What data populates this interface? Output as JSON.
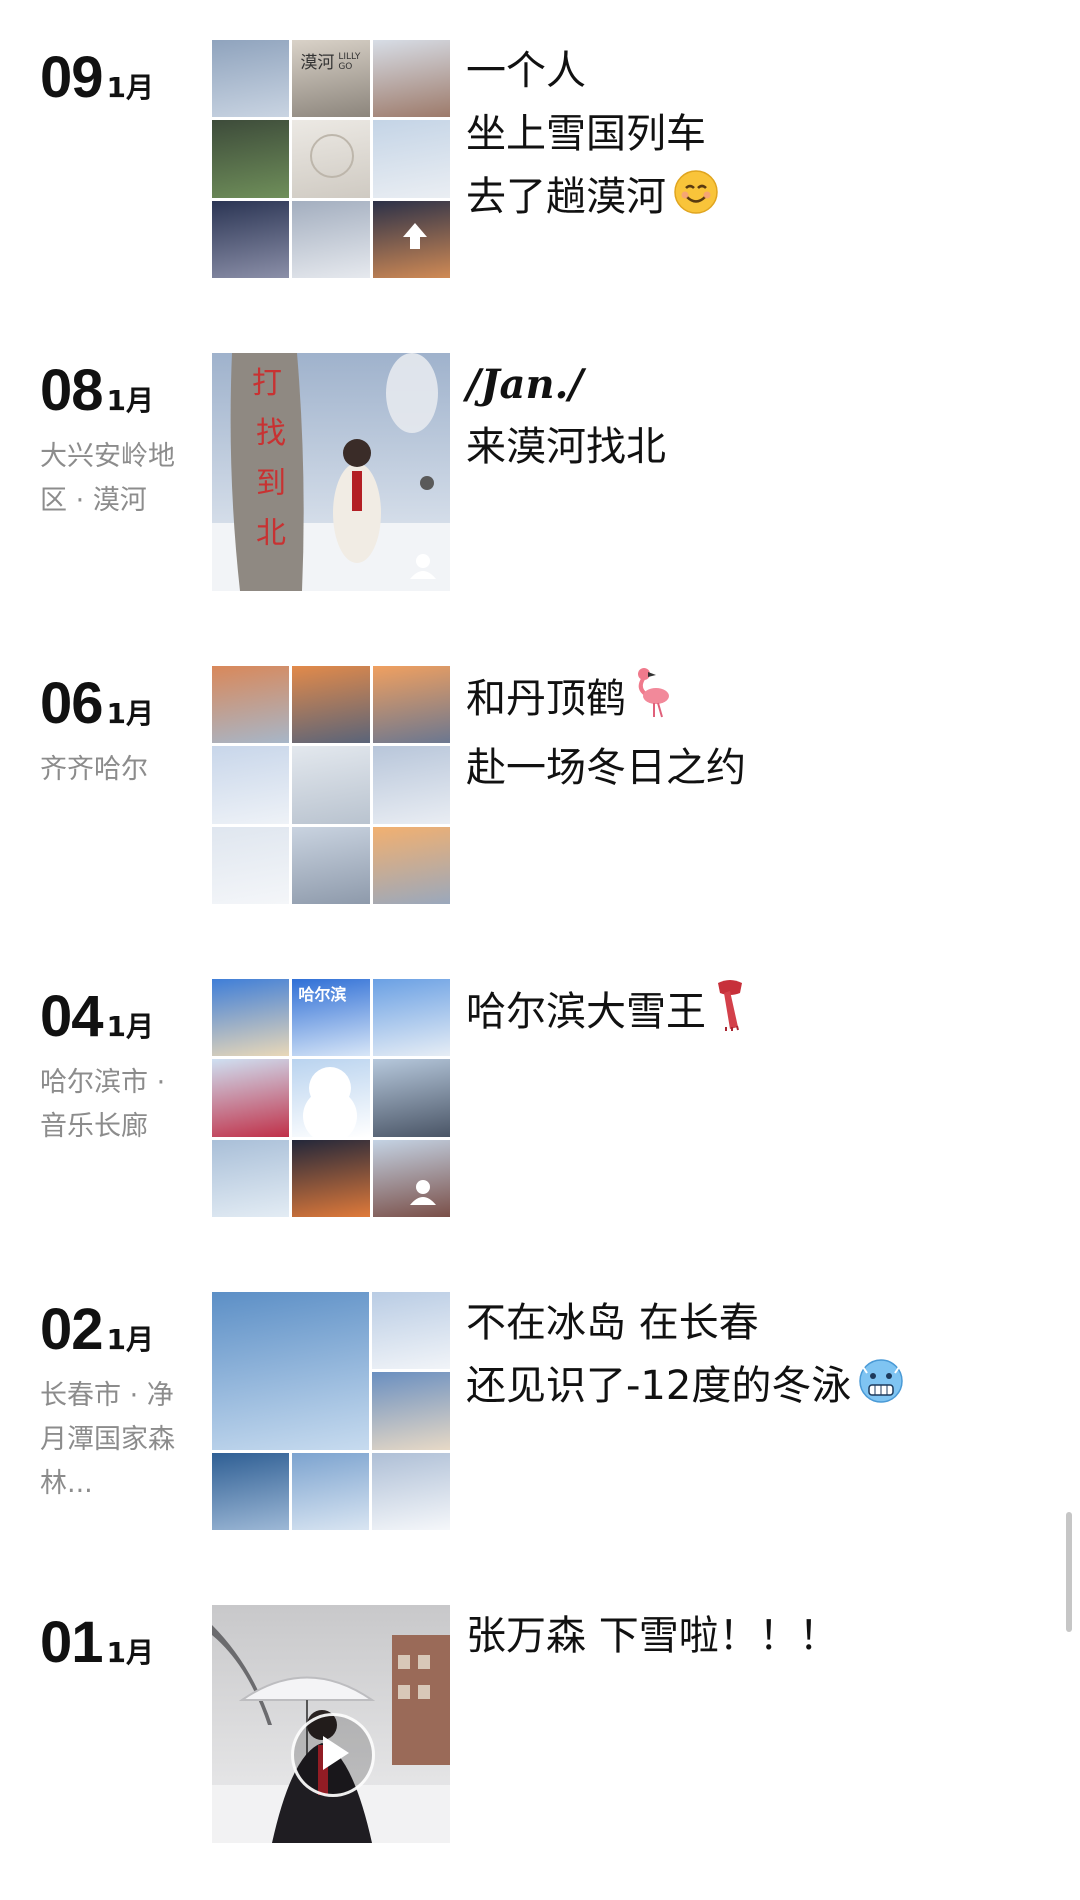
{
  "posts": [
    {
      "day": "09",
      "month": "1月",
      "location": "",
      "caption": [
        "一个人",
        "坐上雪国列车",
        "去了趟漠河"
      ],
      "caption_emoji": "smiling-face-icon",
      "photo_layout": "grid-9",
      "photo_text": [
        "漠河",
        "LILLY GO"
      ],
      "photo_colors": [
        [
          "#8fa3bd",
          "#c9d4e2"
        ],
        [
          "#d9d2c8",
          "#8c857c"
        ],
        [
          "#d7dde6",
          "#9d7a6a"
        ],
        [
          "#3d4b3a",
          "#6f8f5a"
        ],
        [
          "#ece9e4",
          "#cfcac2"
        ],
        [
          "#c4d4e6",
          "#eaeef3"
        ],
        [
          "#2b3554",
          "#8b8fa8"
        ],
        [
          "#a3aebf",
          "#e6e9ee"
        ],
        [
          "#2c3148",
          "#d08a55"
        ]
      ]
    },
    {
      "day": "08",
      "month": "1月",
      "location": "大兴安岭地区 · 漠河",
      "caption_title": "/Jan./",
      "caption": [
        "来漠河找北"
      ],
      "photo_layout": "single",
      "photo_text": [
        "打找到北了"
      ],
      "photo_colors": [
        [
          "#a9b6c9",
          "#e8ecf2"
        ]
      ]
    },
    {
      "day": "06",
      "month": "1月",
      "location": "齐齐哈尔",
      "caption": [
        "和丹顶鹤",
        "赴一场冬日之约"
      ],
      "caption_emoji": "flamingo-icon",
      "photo_layout": "grid-9",
      "photo_colors": [
        [
          "#d9885a",
          "#a7b6c8"
        ],
        [
          "#e28a4a",
          "#5a6479"
        ],
        [
          "#f0a060",
          "#6b7790"
        ],
        [
          "#c8d6ea",
          "#eef2f7"
        ],
        [
          "#e3e8ee",
          "#b9c3cf"
        ],
        [
          "#b8c6da",
          "#e9edf3"
        ],
        [
          "#dfe6ef",
          "#f4f6f9"
        ],
        [
          "#c9d3e0",
          "#8e9aab"
        ],
        [
          "#f2b070",
          "#9aa8bc"
        ]
      ]
    },
    {
      "day": "04",
      "month": "1月",
      "location": "哈尔滨市 · 音乐长廊",
      "caption": [
        "哈尔滨大雪王"
      ],
      "caption_emoji": "scarf-icon",
      "photo_layout": "grid-9",
      "photo_text": [
        "哈尔滨"
      ],
      "photo_colors": [
        [
          "#3f7ed8",
          "#e9d8b8"
        ],
        [
          "#2f6fd6",
          "#d8e6f7"
        ],
        [
          "#6aa0e4",
          "#e6edf5"
        ],
        [
          "#cfe0f2",
          "#c03048"
        ],
        [
          "#b9d3ef",
          "#ffffff"
        ],
        [
          "#b6c8dc",
          "#4a5566"
        ],
        [
          "#a9bfd8",
          "#e3ecf4"
        ],
        [
          "#23273a",
          "#e07a3a"
        ],
        [
          "#c4d3e4",
          "#7a4f48"
        ]
      ]
    },
    {
      "day": "02",
      "month": "1月",
      "location": "长春市 · 净月潭国家森林...",
      "caption": [
        "不在冰岛 在长春",
        "还见识了-12度的冬泳"
      ],
      "caption_emoji": "cold-face-icon",
      "photo_layout": "grid-6",
      "photo_colors": [
        [
          "#5c8fc6",
          "#c7dbef"
        ],
        [
          "#b9cce4",
          "#f1f4f8"
        ],
        [
          "#6a8fc0",
          "#e7d9c6"
        ],
        [
          "#2f5f94",
          "#9db8d6"
        ],
        [
          "#7ca3cf",
          "#d9e5f2"
        ],
        [
          "#aebfd6",
          "#f5f7fa"
        ],
        [
          "#c8d4e3",
          "#f0f3f7"
        ]
      ]
    },
    {
      "day": "01",
      "month": "1月",
      "location": "",
      "caption": [
        "张万森 下雪啦！！！"
      ],
      "photo_layout": "video",
      "photo_colors": [
        [
          "#b9b9bb",
          "#e4e4e6"
        ]
      ]
    }
  ]
}
